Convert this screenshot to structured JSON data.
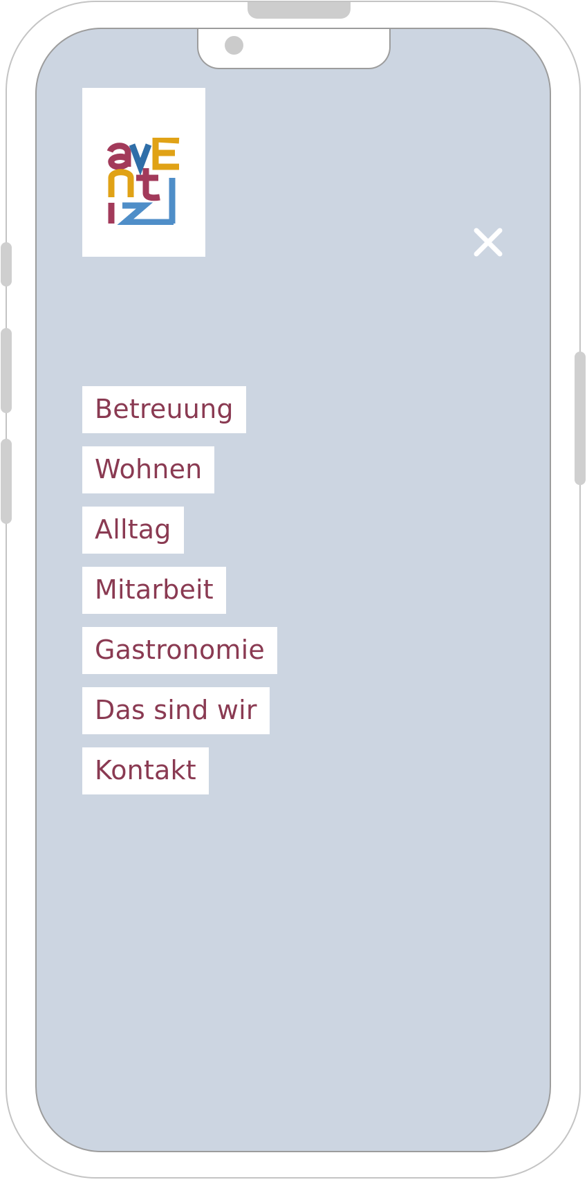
{
  "logo": {
    "letters": [
      "a",
      "v",
      "E",
      "n",
      "t",
      "i",
      "Z"
    ],
    "colors": {
      "red": "#a23a5a",
      "blue": "#2f6ea8",
      "yellow": "#e0a216",
      "blue_light": "#4f8ec8"
    }
  },
  "close_button": {
    "icon": "close-icon",
    "color": "#ffffff"
  },
  "menu": {
    "items": [
      {
        "label": "Betreuung"
      },
      {
        "label": "Wohnen"
      },
      {
        "label": "Alltag"
      },
      {
        "label": "Mitarbeit"
      },
      {
        "label": "Gastronomie"
      },
      {
        "label": "Das sind wir"
      },
      {
        "label": "Kontakt"
      }
    ]
  },
  "theme": {
    "screen_background": "#ccd5e1",
    "menu_text_color": "#8a3a52",
    "menu_item_background": "#ffffff"
  }
}
